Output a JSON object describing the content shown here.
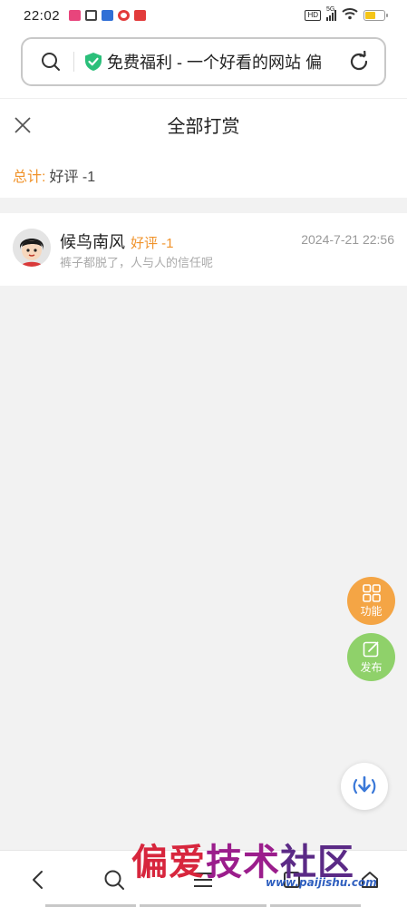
{
  "status_bar": {
    "time": "22:02",
    "hd": "HD",
    "network": "5G",
    "icons": [
      "video-app-icon",
      "camera-app-icon",
      "blue-app-icon",
      "red-map-icon",
      "red-app-icon"
    ]
  },
  "browser": {
    "url_text": "免费福利 - 一个好看的网站 偏",
    "colors": {
      "shield": "#2bbf7a"
    }
  },
  "page": {
    "title": "全部打赏",
    "summary_label": "总计:",
    "summary_value": "好评 -1"
  },
  "records": [
    {
      "name": "候鸟南风",
      "tag": "好评 -1",
      "time": "2024-7-21 22:56",
      "message": "裤子都脱了，人与人的信任呢"
    }
  ],
  "fabs": {
    "function_label": "功能",
    "post_label": "发布"
  },
  "watermark": {
    "title": "偏爱技术社区",
    "url": "www.paijishu.com"
  },
  "colors": {
    "accent_orange": "#f0932b",
    "fab_orange": "#f4a545",
    "fab_green": "#8fd16a",
    "download_blue": "#3a78d8"
  }
}
